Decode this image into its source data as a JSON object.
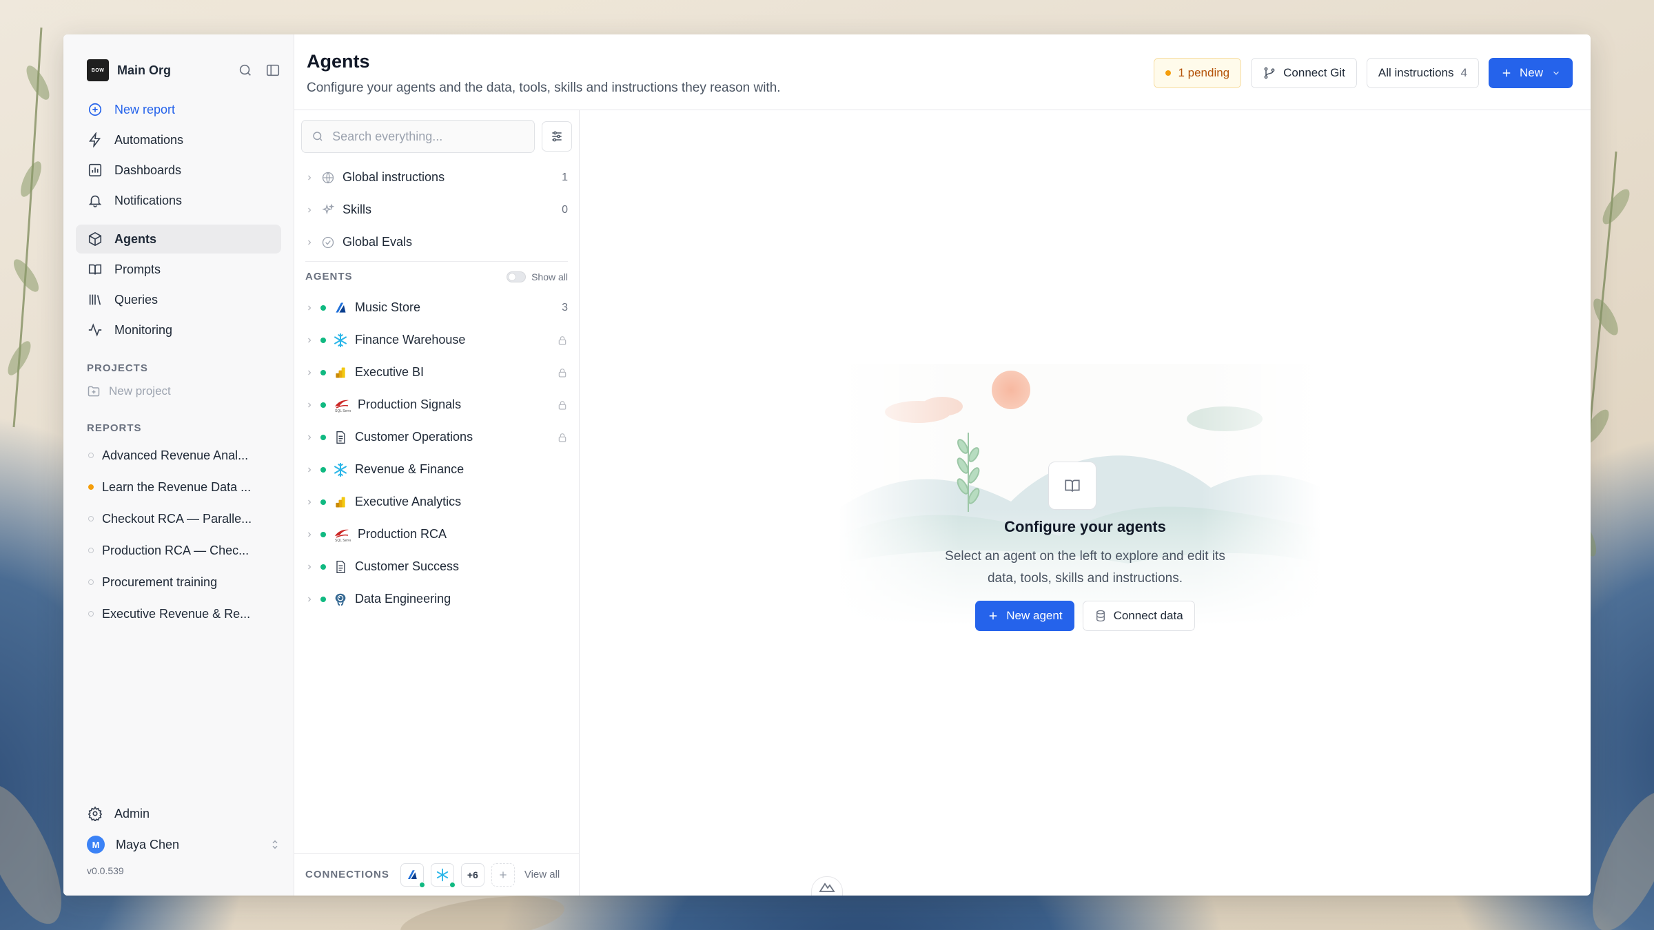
{
  "org": {
    "logo_text": "BOW",
    "name": "Main Org"
  },
  "nav": {
    "new_report": "New report",
    "automations": "Automations",
    "dashboards": "Dashboards",
    "notifications": "Notifications",
    "agents": "Agents",
    "prompts": "Prompts",
    "queries": "Queries",
    "monitoring": "Monitoring"
  },
  "projects": {
    "label": "PROJECTS",
    "new_project": "New project"
  },
  "reports": {
    "label": "REPORTS",
    "items": [
      {
        "title": "Advanced Revenue Anal...",
        "status": "idle"
      },
      {
        "title": "Learn the Revenue Data ...",
        "status": "running"
      },
      {
        "title": "Checkout RCA — Paralle...",
        "status": "idle"
      },
      {
        "title": "Production RCA — Chec...",
        "status": "idle"
      },
      {
        "title": "Procurement training",
        "status": "idle"
      },
      {
        "title": "Executive Revenue & Re...",
        "status": "idle"
      }
    ]
  },
  "footer": {
    "admin": "Admin",
    "user_initial": "M",
    "user_name": "Maya Chen",
    "version": "v0.0.539"
  },
  "header": {
    "title": "Agents",
    "subtitle": "Configure your agents and the data, tools, skills and instructions they reason with.",
    "pending": "1 pending",
    "connect_git": "Connect Git",
    "all_instructions": "All instructions",
    "all_instructions_count": "4",
    "new": "New"
  },
  "search": {
    "placeholder": "Search everything..."
  },
  "tree": {
    "global_instructions": {
      "label": "Global instructions",
      "count": "1"
    },
    "skills": {
      "label": "Skills",
      "count": "0"
    },
    "global_evals": {
      "label": "Global Evals"
    }
  },
  "agents": {
    "label": "AGENTS",
    "show_all": "Show all",
    "items": [
      {
        "name": "Music Store",
        "source": "azure-sql-icon",
        "count": "3",
        "locked": false
      },
      {
        "name": "Finance Warehouse",
        "source": "snowflake-icon",
        "count": "",
        "locked": true
      },
      {
        "name": "Executive BI",
        "source": "powerbi-icon",
        "count": "",
        "locked": true
      },
      {
        "name": "Production Signals",
        "source": "sqlserver-icon",
        "count": "",
        "locked": true
      },
      {
        "name": "Customer Operations",
        "source": "document-icon",
        "count": "",
        "locked": true
      },
      {
        "name": "Revenue & Finance",
        "source": "snowflake-icon",
        "count": "",
        "locked": false
      },
      {
        "name": "Executive Analytics",
        "source": "powerbi-icon",
        "count": "",
        "locked": false
      },
      {
        "name": "Production RCA",
        "source": "sqlserver-icon",
        "count": "",
        "locked": false
      },
      {
        "name": "Customer Success",
        "source": "document-icon",
        "count": "",
        "locked": false
      },
      {
        "name": "Data Engineering",
        "source": "postgres-icon",
        "count": "",
        "locked": false
      }
    ]
  },
  "connections": {
    "label": "CONNECTIONS",
    "more": "+6",
    "view_all": "View all"
  },
  "empty": {
    "title": "Configure your agents",
    "sub_line1": "Select an agent on the left to explore and edit its",
    "sub_line2": "data, tools, skills and instructions.",
    "new_agent": "New agent",
    "connect_data": "Connect data"
  },
  "colors": {
    "accent": "#2563eb",
    "live": "#10b981",
    "pending": "#f59e0b"
  }
}
